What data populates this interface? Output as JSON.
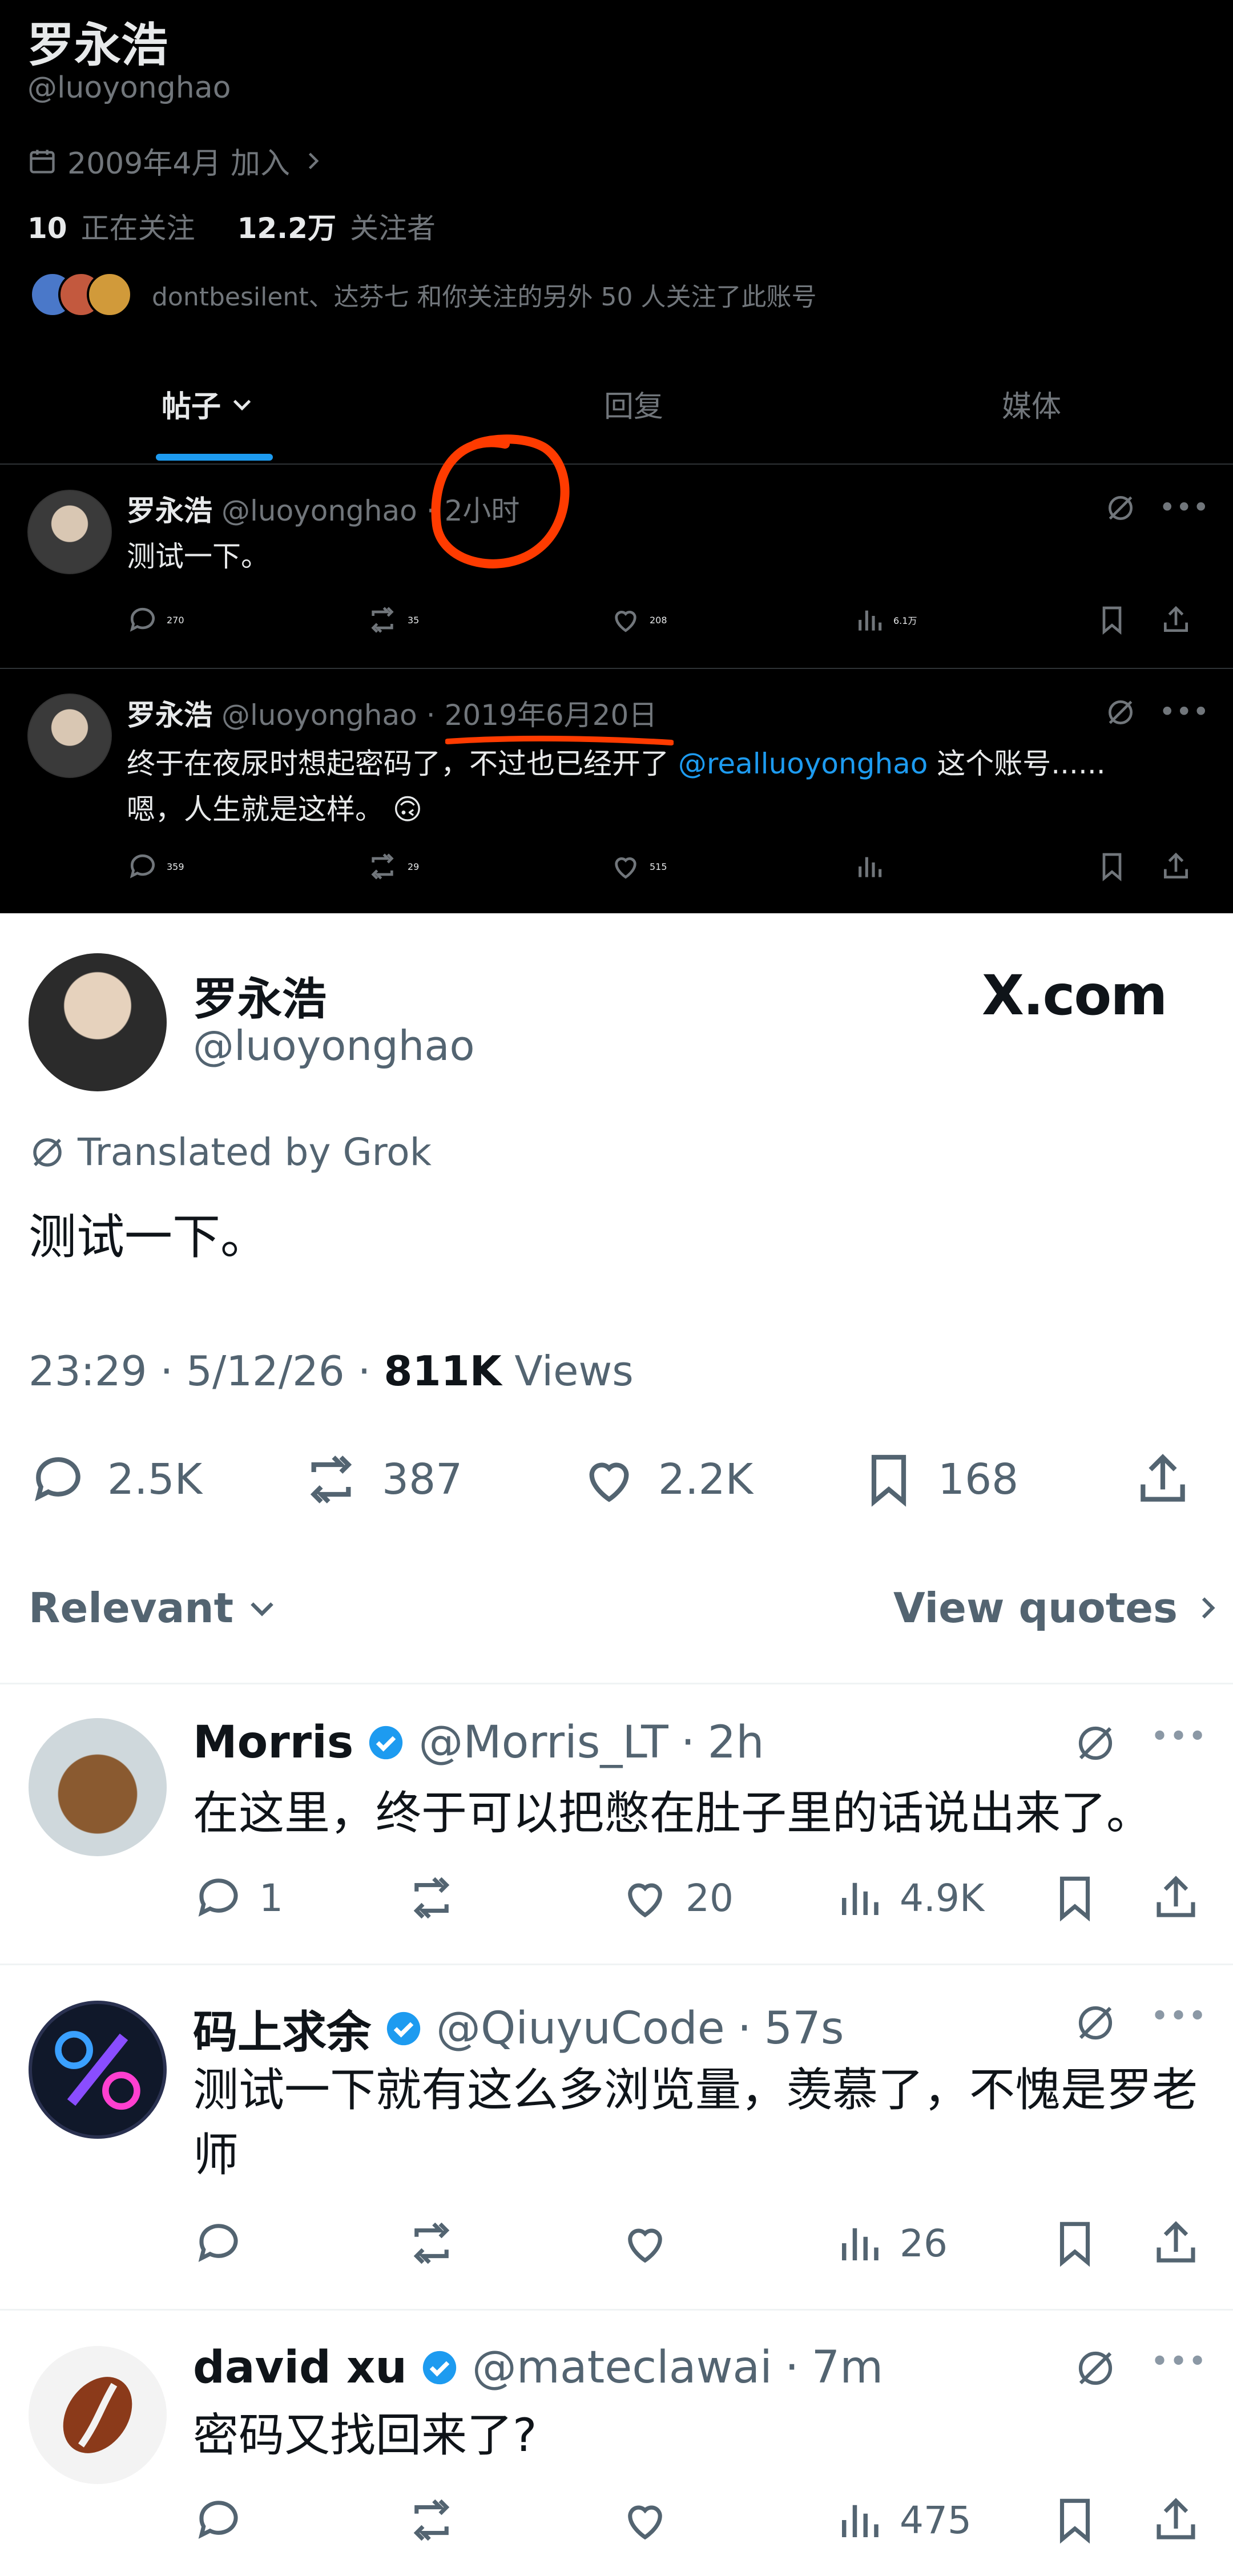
{
  "profile": {
    "name": "罗永浩",
    "handle": "@luoyonghao",
    "joined": "2009年4月 加入",
    "following_count": "10",
    "following_label": "正在关注",
    "followers_count": "12.2万",
    "followers_label": "关注者",
    "followed_by": "dontbesilent、达芬七 和你关注的另外 50 人关注了此账号"
  },
  "tabs": [
    {
      "label": "帖子",
      "active": true
    },
    {
      "label": "回复",
      "active": false
    },
    {
      "label": "媒体",
      "active": false
    }
  ],
  "profile_posts": [
    {
      "name": "罗永浩",
      "handle": "@luoyonghao",
      "sep": "·",
      "time": "2小时",
      "text": "测试一下。",
      "replies": "270",
      "reposts": "35",
      "likes": "208",
      "views": "6.1万"
    },
    {
      "name": "罗永浩",
      "handle": "@luoyonghao",
      "sep": "·",
      "time": "2019年6月20日",
      "text_before": "终于在夜尿时想起密码了，不过也已经开了",
      "mention": "@realluoyonghao",
      "text_after": "这个账号......",
      "text_line2": "嗯，人生就是这样。",
      "emoji": "🙃",
      "replies": "359",
      "reposts": "29",
      "likes": "515",
      "views": ""
    }
  ],
  "annotations": {
    "circle_color": "#ff3b00",
    "underline_color": "#ff3b00"
  },
  "main_post": {
    "name": "罗永浩",
    "handle": "@luoyonghao",
    "brand": "X.com",
    "translated_by": "Translated by Grok",
    "text": "测试一下。",
    "time": "23:29",
    "date": "5/12/26",
    "sep": "·",
    "views_count": "811K",
    "views_label": "Views",
    "replies": "2.5K",
    "reposts": "387",
    "likes": "2.2K",
    "bookmarks": "168"
  },
  "sort": {
    "label": "Relevant",
    "quotes": "View quotes"
  },
  "replies": [
    {
      "name": "Morris",
      "handle": "@Morris_LT",
      "sep": "·",
      "time": "2h",
      "text": "在这里，终于可以把憋在肚子里的话说出来了。",
      "replies": "1",
      "reposts": "",
      "likes": "20",
      "views": "4.9K"
    },
    {
      "name": "码上求余",
      "handle": "@QiuyuCode",
      "sep": "·",
      "time": "57s",
      "text": "测试一下就有这么多浏览量，羡慕了，不愧是罗老师",
      "replies": "",
      "reposts": "",
      "likes": "",
      "views": "26"
    },
    {
      "name": "david xu",
      "handle": "@mateclawai",
      "sep": "·",
      "time": "7m",
      "text": "密码又找回来了?",
      "replies": "",
      "reposts": "",
      "likes": "",
      "views": "475"
    }
  ],
  "colors": {
    "dark_bg": "#000000",
    "accent_blue": "#1d9bf0",
    "verified_blue": "#1d9bf0",
    "light_text": "#0f1419",
    "light_gray": "#536471"
  }
}
